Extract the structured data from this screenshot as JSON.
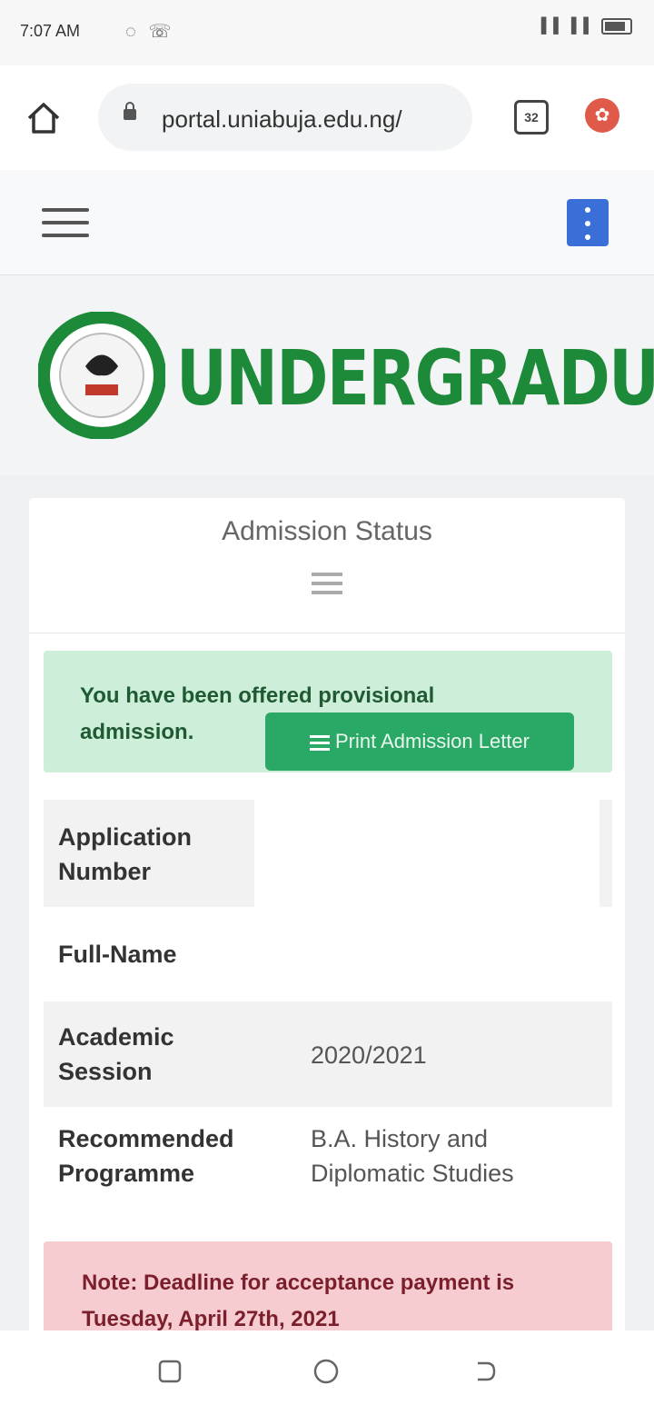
{
  "status_bar": {
    "time": "7:07 AM",
    "left_icons": "◌ ☏",
    "right_icons": "▌▌ ▌▌"
  },
  "browser": {
    "url": "portal.uniabuja.edu.ng/",
    "tab_count": "32"
  },
  "banner": {
    "title": "UNDERGRADUATE"
  },
  "card": {
    "title": "Admission Status",
    "success_message": "You have been offered provisional admission.",
    "print_button": "Print Admission Letter",
    "rows": [
      {
        "label": "Application Number",
        "value": ""
      },
      {
        "label": "Full-Name",
        "value": ""
      },
      {
        "label": "Academic Session",
        "value": "2020/2021"
      },
      {
        "label": "Recommended Programme",
        "value": "B.A. History and Diplomatic Studies"
      }
    ],
    "note": "Note: Deadline for acceptance payment is Tuesday, April 27th, 2021"
  },
  "colors": {
    "brand_green": "#1d8a3a",
    "button_green": "#2aa865",
    "menu_blue": "#3b6fd8"
  }
}
